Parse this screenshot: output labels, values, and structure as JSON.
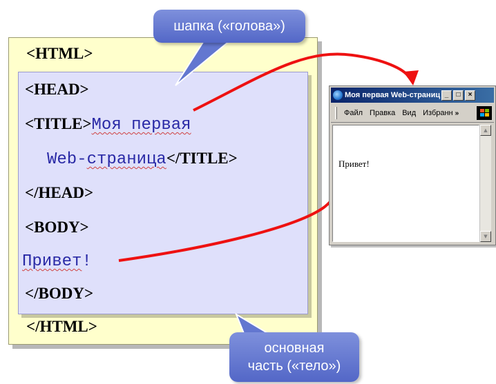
{
  "callouts": {
    "head": "шапка («голова»)",
    "body_line1": "основная",
    "body_line2": "часть («тело»)"
  },
  "code": {
    "html_open": "<HTML>",
    "head_open": "<HEAD>",
    "title_open": "<TITLE>",
    "title_text_1": "Моя первая",
    "title_text_2a": "Web-",
    "title_text_2b": "страница",
    "title_close": "</TITLE>",
    "head_close": "</HEAD>",
    "body_open": "<BODY>",
    "body_text": "Привет",
    "body_text_excl": "!",
    "body_close": "</BODY>",
    "html_close": "</HTML>"
  },
  "browser": {
    "title": "Моя первая Web-страница ...",
    "btn_min": "_",
    "btn_max": "□",
    "btn_close": "×",
    "menu": [
      "Файл",
      "Правка",
      "Вид",
      "Избранн"
    ],
    "menu_more": "»",
    "page_text": "Привет!",
    "scroll_up": "▲",
    "scroll_down": "▼"
  },
  "colors": {
    "outer_box": "#ffffcc",
    "inner_box": "#dfe0fb",
    "callout": "#6377d0",
    "arrow": "#ee1111",
    "code_blue": "#2a2aa6"
  }
}
